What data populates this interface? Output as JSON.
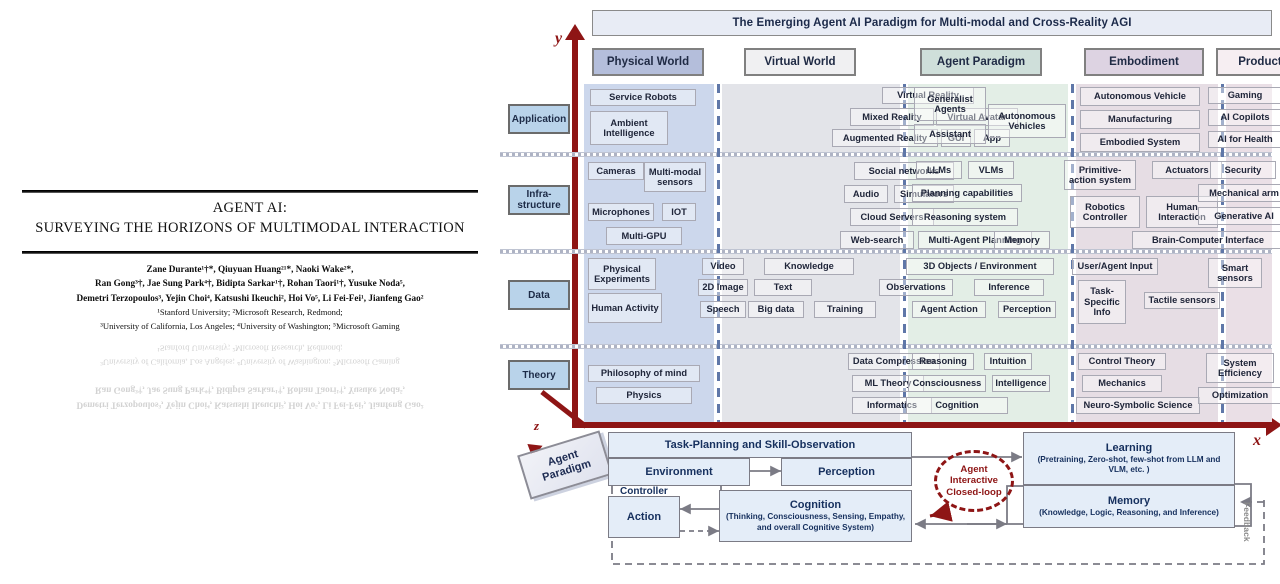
{
  "paper": {
    "title_line1": "AGENT AI:",
    "title_line2": "SURVEYING THE HORIZONS OF MULTIMODAL INTERACTION",
    "authors_line1": "Zane Durante¹†*, Qiuyuan Huang²¹*, Naoki Wake²*,",
    "authors_line2": "Ran Gong³†, Jae Sung Park⁴†, Bidipta Sarkar¹†, Rohan Taori¹†, Yusuke Noda⁵,",
    "authors_line3": "Demetri Terzopoulos³, Yejin Choi⁴, Katsushi Ikeuchi², Hoi Vo⁵, Li Fei-Fei¹, Jianfeng Gao²",
    "affil_line1": "¹Stanford University; ²Microsoft Research, Redmond;",
    "affil_line2": "³University of California, Los Angeles; ⁴University of Washington; ⁵Microsoft Gaming"
  },
  "figure": {
    "banner": "The Emerging Agent AI Paradigm for Multi-modal and Cross-Reality AGI",
    "axis_y": "y",
    "axis_x": "x",
    "axis_z": "z",
    "paradigm_tag": "Agent Paradigm",
    "columns": [
      {
        "label": "Physical World",
        "head_bg": "#b4bedb",
        "band_bg": "#ccd7ec"
      },
      {
        "label": "Virtual World",
        "head_bg": "#f0f0f2",
        "band_bg": "#e3e4e9"
      },
      {
        "label": "Agent Paradigm",
        "head_bg": "#cfdfda",
        "band_bg": "#e3eee6"
      },
      {
        "label": "Embodiment",
        "head_bg": "#ddd3e2",
        "band_bg": "#e6dde4"
      },
      {
        "label": "Product",
        "head_bg": "#f6eef2",
        "band_bg": "#eadfe6"
      }
    ],
    "rows": [
      {
        "label": "Application"
      },
      {
        "label": "Infra-\nstructure"
      },
      {
        "label": "Data"
      },
      {
        "label": "Theory"
      }
    ],
    "nodes": {
      "application": {
        "physical_world": [
          "Service Robots",
          "Ambient Intelligence"
        ],
        "virtual_world": [
          "Virtual Reality",
          "Mixed Reality",
          "Virtual Avatar",
          "Augmented Reality",
          "GUI",
          "App"
        ],
        "agent_paradigm": [
          "Generalist Agents",
          "Autonomous Vehicles",
          "Assistant"
        ],
        "embodiment": [
          "Autonomous Vehicle",
          "Manufacturing",
          "Embodied System"
        ],
        "product": [
          "Gaming",
          "AI Copilots",
          "AI for Health"
        ]
      },
      "infrastructure": {
        "physical_world": [
          "Cameras",
          "Multi-modal sensors",
          "Microphones",
          "IOT",
          "Multi-GPU"
        ],
        "virtual_world": [
          "Social networks",
          "Audio",
          "Simulators",
          "Cloud Servers",
          "Web-search",
          "Multi-Agent Planning"
        ],
        "agent_paradigm": [
          "LLMs",
          "VLMs",
          "Planning capabilities",
          "Reasoning system",
          "Memory"
        ],
        "embodiment": [
          "Primitive-action system",
          "Actuators",
          "Robotics Controller",
          "Human Interaction",
          "Brain-Computer Interface"
        ],
        "product": [
          "Security",
          "Mechanical arm",
          "Generative AI"
        ]
      },
      "data": {
        "physical_world": [
          "Physical Experiments",
          "Human Activity"
        ],
        "virtual_world": [
          "Video",
          "2D Image",
          "Speech",
          "Knowledge",
          "Text",
          "Big data",
          "Training"
        ],
        "agent_paradigm": [
          "Observations",
          "3D Objects / Environment",
          "Inference",
          "Agent Action",
          "Perception"
        ],
        "embodiment": [
          "User/Agent  Input",
          "Task-Specific Info",
          "Tactile sensors"
        ],
        "product": [
          "Smart sensors"
        ]
      },
      "theory": {
        "physical_world": [
          "Philosophy of mind",
          "Physics"
        ],
        "virtual_world": [
          "Data Compression",
          "ML Theory",
          "Informatics"
        ],
        "agent_paradigm": [
          "Reasoning",
          "Intuition",
          "Consciousness",
          "Intelligence",
          "Cognition"
        ],
        "embodiment": [
          "Control Theory",
          "Mechanics",
          "Neuro-Symbolic Science"
        ],
        "product": [
          "System Efficiency",
          "Optimization"
        ]
      }
    }
  },
  "flow": {
    "task_planning": "Task-Planning and Skill-Observation",
    "environment": "Environment",
    "perception": "Perception",
    "controller": "Controller",
    "action": "Action",
    "cognition_title": "Cognition",
    "cognition_sub": "(Thinking, Consciousness, Sensing, Empathy, and overall Cognitive System)",
    "loop": "Agent Interactive Closed-loop",
    "learning_title": "Learning",
    "learning_sub": "(Pretraining, Zero-shot, few-shot from LLM and VLM, etc. )",
    "memory_title": "Memory",
    "memory_sub": "(Knowledge, Logic, Reasoning, and Inference)",
    "feedback": "Feedback"
  },
  "colors": {
    "axis_red": "#8e1515",
    "banner_bg": "#e8ecf5",
    "row_label_bg": "#b9d3ea",
    "flow_box_bg": "#e4edf8",
    "node_text": "#20263a"
  }
}
